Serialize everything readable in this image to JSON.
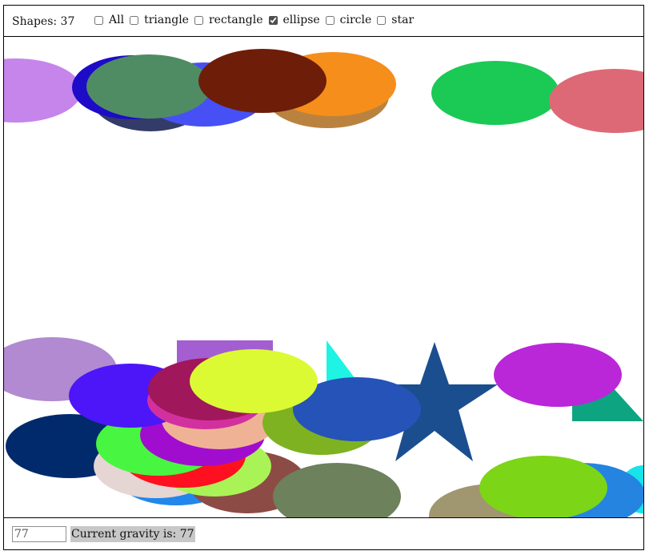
{
  "toolbar": {
    "shape_count_label": "Shapes: 37",
    "filters": [
      {
        "label": "All",
        "checked": false
      },
      {
        "label": "triangle",
        "checked": false
      },
      {
        "label": "rectangle",
        "checked": false
      },
      {
        "label": "ellipse",
        "checked": true
      },
      {
        "label": "circle",
        "checked": false
      },
      {
        "label": "star",
        "checked": false
      }
    ]
  },
  "gravity": {
    "input_value": "77",
    "label": "Current gravity is: 77"
  },
  "colors": {
    "border": "#000000",
    "label_bg": "#c8c8c8",
    "canvas_bg": "#ffffff"
  }
}
